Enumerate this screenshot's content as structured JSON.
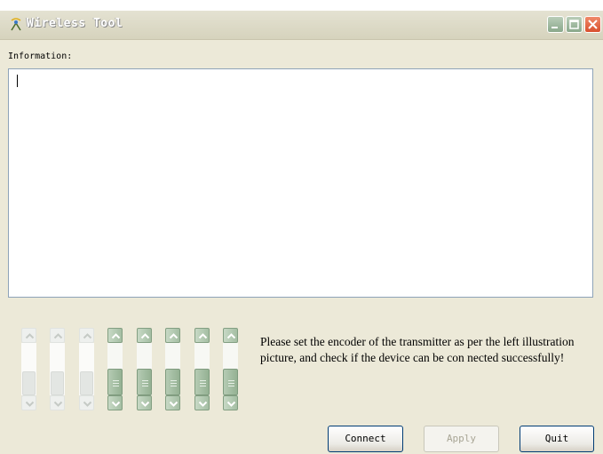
{
  "window": {
    "title": "Wireless Tool",
    "icon": "antenna-icon",
    "controls": [
      "minimize-icon",
      "maximize-icon",
      "close-icon"
    ]
  },
  "info": {
    "label": "Information:",
    "value": ""
  },
  "sliders": [
    {
      "state": "disabled",
      "level": 0.45
    },
    {
      "state": "disabled",
      "level": 0.45
    },
    {
      "state": "disabled",
      "level": 0.45
    },
    {
      "state": "enabled",
      "level": 0.5
    },
    {
      "state": "enabled",
      "level": 0.5
    },
    {
      "state": "enabled",
      "level": 0.5
    },
    {
      "state": "enabled",
      "level": 0.5
    },
    {
      "state": "enabled",
      "level": 0.5
    }
  ],
  "instruction": "Please set the encoder of the transmitter as per the left illustration picture, and check if the device can be con nected successfully!",
  "buttons": {
    "connect": "Connect",
    "apply": "Apply",
    "quit": "Quit"
  },
  "colors": {
    "window_bg": "#ece9d8",
    "close_button": "#d8502e",
    "slider_green": "#a4bea3"
  }
}
